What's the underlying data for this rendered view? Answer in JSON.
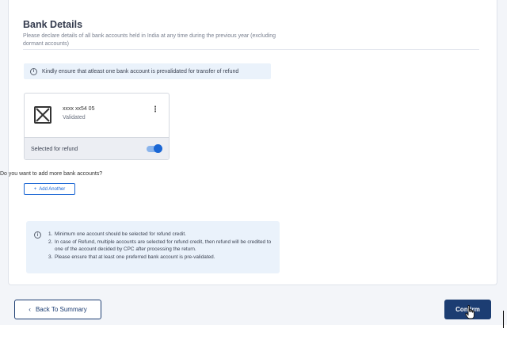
{
  "section": {
    "title": "Bank Details",
    "subtitle": "Please declare details of all bank accounts held in India at any time during the previous year (excluding dormant accounts)"
  },
  "note": {
    "text": "Kindly ensure that atleast one bank account is prevalidated for transfer of refund",
    "icon": "info-icon"
  },
  "bank_account": {
    "number": "xxxx xx54 05",
    "status": "Validated",
    "refund_label": "Selected for refund",
    "refund_selected": true,
    "menu_icon": "kebab-menu-icon",
    "logo_icon": "bank-logo-placeholder-icon"
  },
  "add_more": {
    "question": "Do you want to add more bank accounts?",
    "button_plus": "+",
    "button_label": "Add Another"
  },
  "info_box": {
    "items": [
      {
        "num": "1.",
        "text": "Minimum one account should be selected for refund credit."
      },
      {
        "num": "2.",
        "text": "In case of Refund, multiple accounts are selected for refund credit, then refund will be credited to one of the account decided by CPC after processing the return."
      },
      {
        "num": "3.",
        "text": "Please ensure that at least one preferred bank account is pre-validated."
      }
    ]
  },
  "footer": {
    "back_chevron": "‹",
    "back_label": "Back To Summary",
    "confirm_label": "Confirm"
  },
  "colors": {
    "primary": "#1c3d72",
    "accent": "#1a66d4",
    "info_bg": "#eaf2fb"
  }
}
